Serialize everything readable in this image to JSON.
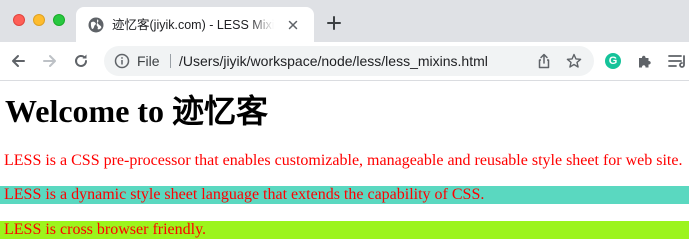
{
  "browser": {
    "tab": {
      "title": "迹忆客(jiyik.com) - LESS Mixins"
    },
    "omnibox": {
      "scheme_label": "File",
      "url": "/Users/jiyik/workspace/node/less/less_mixins.html"
    },
    "extension_letter": "G"
  },
  "page": {
    "heading": "Welcome to 迹忆客",
    "paragraphs": [
      {
        "text": "LESS is a CSS pre-processor that enables customizable, manageable and reusable style sheet for web site.",
        "color": "#ff0000",
        "background": "#ffffff"
      },
      {
        "text": "LESS is a dynamic style sheet language that extends the capability of CSS.",
        "color": "#ff0000",
        "background": "#5ad8c0"
      },
      {
        "text": "LESS is cross browser friendly.",
        "color": "#ff0000",
        "background": "#9cf41c"
      }
    ]
  },
  "colors": {
    "tabbar": "#dfe1e5",
    "omnibox": "#f1f3f4",
    "accent_green": "#15c39a"
  }
}
